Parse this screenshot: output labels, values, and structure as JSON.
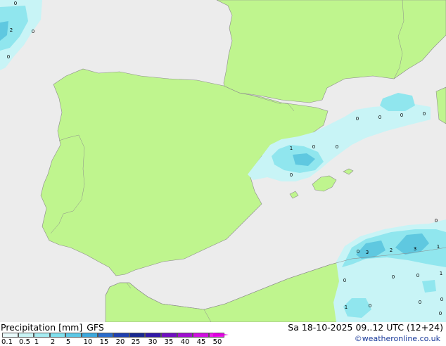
{
  "map": {
    "colors": {
      "sea": "#ececec",
      "land": "#bff58e",
      "coast": "#8c8c8c",
      "precip_light": "#c8f4f6",
      "precip_mid": "#90e6ee",
      "precip_heavy": "#5fc8e0"
    },
    "labels": [
      "2",
      "0",
      "0",
      "0",
      "1",
      "0",
      "0",
      "0",
      "0",
      "0",
      "0",
      "0",
      "0",
      "0",
      "3",
      "2",
      "3",
      "1",
      "0",
      "1",
      "0",
      "0",
      "1",
      "0",
      "0",
      "0",
      "0"
    ]
  },
  "legend": {
    "title": "Precipitation [mm]",
    "model": "GFS",
    "valid_time": "Sa 18-10-2025 09..12 UTC (12+24)",
    "credit": "©weatheronline.co.uk",
    "ticks": [
      "0.1",
      "0.5",
      "1",
      "2",
      "5",
      "10",
      "15",
      "20",
      "25",
      "30",
      "35",
      "40",
      "45",
      "50"
    ],
    "colorbar": [
      "#e8fbfc",
      "#c8f4f6",
      "#a6ecf2",
      "#80e0ee",
      "#5cc8e6",
      "#3ca8dc",
      "#2a6ccc",
      "#2040b0",
      "#182890",
      "#3018a8",
      "#7010c0",
      "#a010d0",
      "#d010e0",
      "#e820e8"
    ]
  }
}
